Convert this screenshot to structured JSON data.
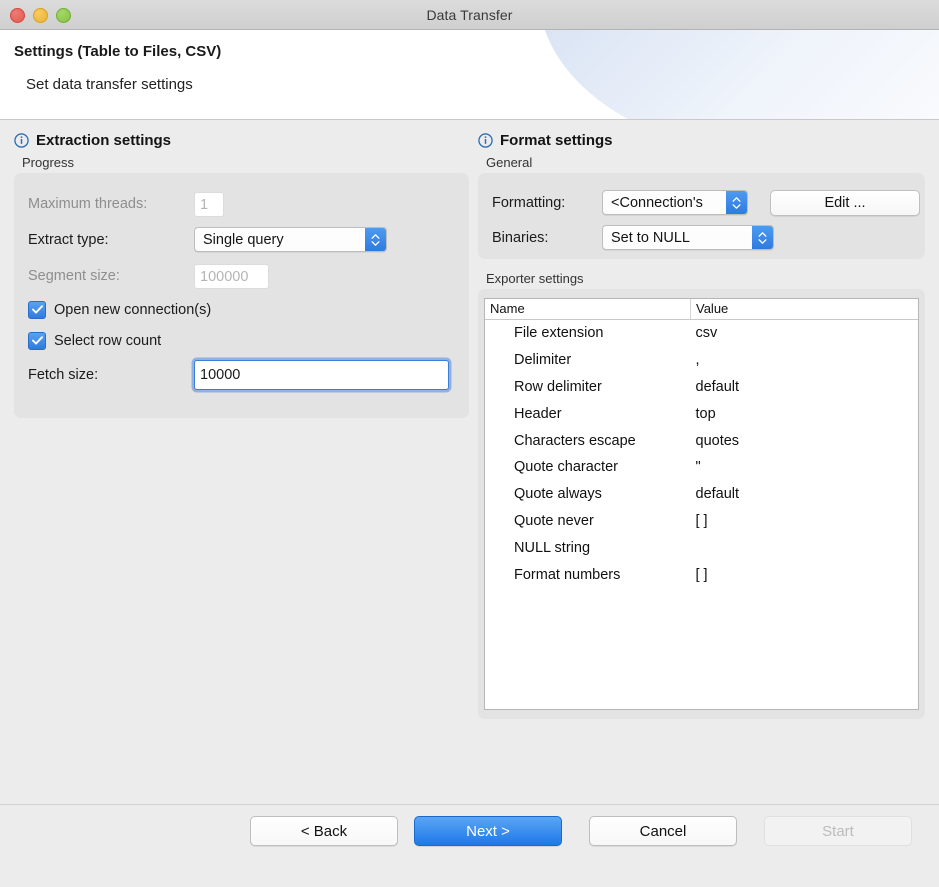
{
  "window": {
    "title": "Data Transfer",
    "traffic_lights": [
      "close-light",
      "minimize-light",
      "maximize-light"
    ]
  },
  "header": {
    "title": "Settings (Table to Files, CSV)",
    "subtitle": "Set data transfer settings"
  },
  "colors": {
    "accent": "#2f7ae0",
    "window_bg": "#ececec",
    "group_bg": "#e3e3e3",
    "focus_ring": "#6496e1"
  },
  "extraction": {
    "section_title": "Extraction settings",
    "section_icon": "info-icon",
    "group_label": "Progress",
    "max_threads": {
      "label": "Maximum threads:",
      "value": "1",
      "enabled": false
    },
    "extract_type": {
      "label": "Extract type:",
      "value": "Single query",
      "enabled": true
    },
    "segment_size": {
      "label": "Segment size:",
      "value": "100000",
      "enabled": false
    },
    "open_new_connections": {
      "label": "Open new connection(s)",
      "checked": true
    },
    "select_row_count": {
      "label": "Select row count",
      "checked": true
    },
    "fetch_size": {
      "label": "Fetch size:",
      "value": "10000",
      "enabled": true,
      "focused": true
    }
  },
  "format": {
    "section_title": "Format settings",
    "section_icon": "info-icon",
    "general_label": "General",
    "formatting": {
      "label": "Formatting:",
      "value": "<Connection's"
    },
    "binaries": {
      "label": "Binaries:",
      "value": "Set to NULL"
    },
    "edit_button": "Edit ...",
    "exporter_label": "Exporter settings",
    "table": {
      "columns": [
        "Name",
        "Value"
      ],
      "rows": [
        {
          "name": "File extension",
          "value": "csv"
        },
        {
          "name": "Delimiter",
          "value": ","
        },
        {
          "name": "Row delimiter",
          "value": "default"
        },
        {
          "name": "Header",
          "value": "top"
        },
        {
          "name": "Characters escape",
          "value": "quotes"
        },
        {
          "name": "Quote character",
          "value": "\""
        },
        {
          "name": "Quote always",
          "value": "default"
        },
        {
          "name": "Quote never",
          "value": "[ ]"
        },
        {
          "name": "NULL string",
          "value": ""
        },
        {
          "name": "Format numbers",
          "value": "[ ]"
        }
      ]
    }
  },
  "footer": {
    "back": "< Back",
    "next": "Next >",
    "cancel": "Cancel",
    "start": "Start"
  }
}
